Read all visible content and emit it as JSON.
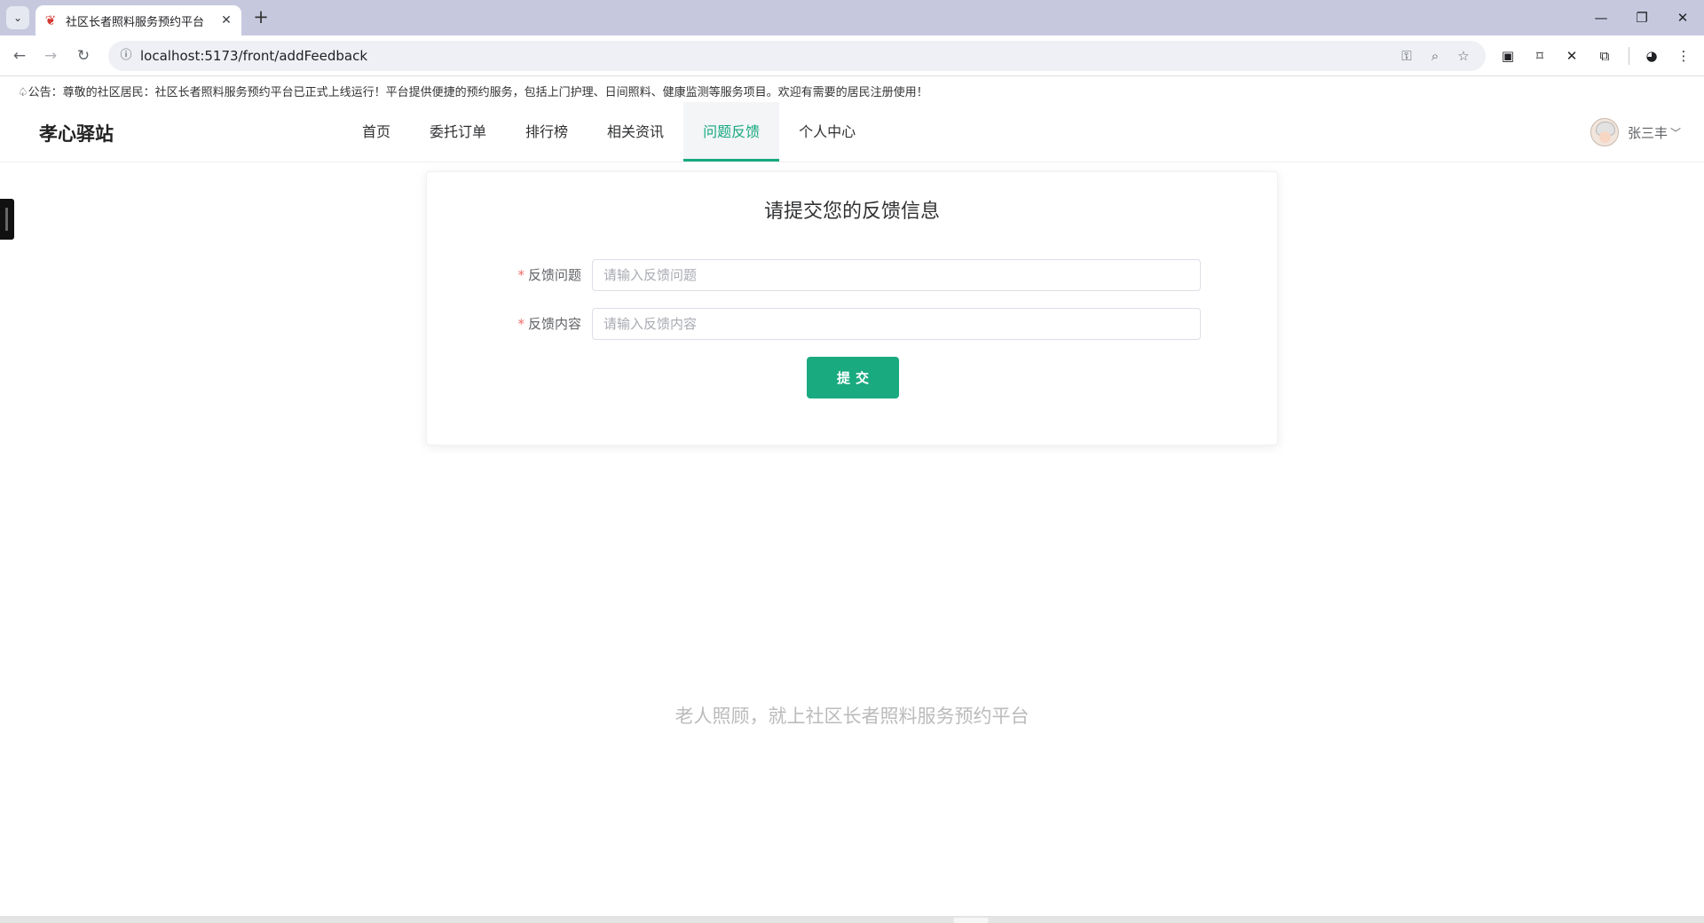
{
  "browser": {
    "tab_title": "社区长者照料服务预约平台",
    "tab_close": "✕",
    "new_tab": "+",
    "url": "localhost:5173/front/addFeedback",
    "window_controls": {
      "minimize": "—",
      "restore": "❐",
      "close": "✕"
    }
  },
  "announcement": "公告：尊敬的社区居民：社区长者照料服务预约平台已正式上线运行！平台提供便捷的预约服务，包括上门护理、日间照料、健康监测等服务项目。欢迎有需要的居民注册使用！",
  "header": {
    "logo": "孝心驿站",
    "nav": [
      {
        "label": "首页"
      },
      {
        "label": "委托订单"
      },
      {
        "label": "排行榜"
      },
      {
        "label": "相关资讯"
      },
      {
        "label": "问题反馈",
        "active": true
      },
      {
        "label": "个人中心"
      }
    ],
    "user_name": "张三丰"
  },
  "form": {
    "title": "请提交您的反馈信息",
    "fields": [
      {
        "label": "反馈问题",
        "required_mark": "*",
        "value": "",
        "placeholder": "请输入反馈问题"
      },
      {
        "label": "反馈内容",
        "required_mark": "*",
        "value": "",
        "placeholder": "请输入反馈内容"
      }
    ],
    "submit_label": "提交"
  },
  "footer": {
    "slogan": "老人照顾，就上社区长者照料服务预约平台"
  },
  "colors": {
    "accent": "#1aaa80",
    "required": "#f56c6c",
    "tabbar": "#c6c9de"
  }
}
